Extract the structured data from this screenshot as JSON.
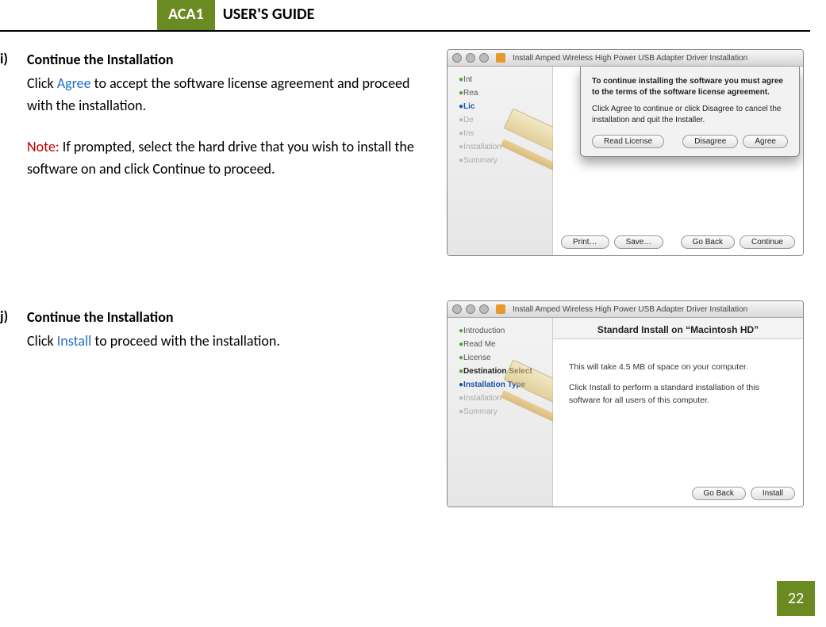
{
  "header": {
    "badge": "ACA1",
    "title": "USER'S GUIDE"
  },
  "page_number": "22",
  "step_i": {
    "label": "i)",
    "title": "Continue the Installation",
    "click_word": "Click ",
    "agree": "Agree",
    "after_agree": " to accept the software license agreement and proceed with the installation.",
    "note_label": "Note:",
    "note_text": " If prompted, select the hard drive that you wish to install the software on and click Continue to proceed."
  },
  "step_j": {
    "label": "j)",
    "title": "Continue the Installation",
    "click_word": "Click ",
    "install": "Install",
    "after_install": " to proceed with the installation."
  },
  "win1": {
    "title": "Install Amped Wireless High Power USB Adapter Driver Installation",
    "sheet_bold": "To continue installing the software you must agree to the terms of the software license agreement.",
    "sheet_text": "Click Agree to continue or click Disagree to cancel the installation and quit the Installer.",
    "btn_read": "Read License",
    "btn_disagree": "Disagree",
    "btn_agree": "Agree",
    "sidebar": {
      "intro": "Int",
      "readme": "Rea",
      "license": "Lic",
      "dest": "De",
      "type": "Ins",
      "install": "Installation",
      "summary": "Summary"
    },
    "footer": {
      "print": "Print…",
      "save": "Save…",
      "back": "Go Back",
      "cont": "Continue"
    }
  },
  "win2": {
    "title": "Install Amped Wireless High Power USB Adapter Driver Installation",
    "heading": "Standard Install on “Macintosh HD”",
    "line1": "This will take 4.5 MB of space on your computer.",
    "line2": "Click Install to perform a standard installation of this software for all users of this computer.",
    "sidebar": {
      "intro": "Introduction",
      "readme": "Read Me",
      "license": "License",
      "dest": "Destination Select",
      "type": "Installation Type",
      "install": "Installation",
      "summary": "Summary"
    },
    "footer": {
      "back": "Go Back",
      "install": "Install"
    }
  }
}
